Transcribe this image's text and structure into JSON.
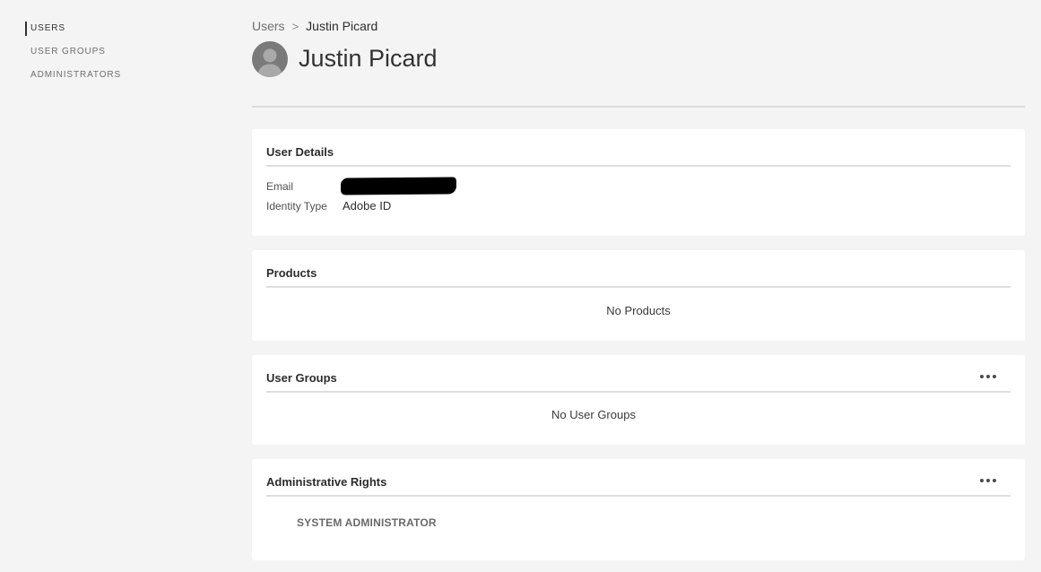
{
  "sidebar": {
    "items": [
      {
        "label": "USERS",
        "active": true
      },
      {
        "label": "USER GROUPS",
        "active": false
      },
      {
        "label": "ADMINISTRATORS",
        "active": false
      }
    ]
  },
  "breadcrumb": {
    "parent": "Users",
    "separator": ">",
    "current": "Justin Picard"
  },
  "user": {
    "name": "Justin Picard",
    "avatar_icon": "user-avatar-icon"
  },
  "user_details": {
    "title": "User Details",
    "email_label": "Email",
    "email_value": "[redacted]",
    "identity_label": "Identity Type",
    "identity_value": "Adobe ID"
  },
  "products": {
    "title": "Products",
    "empty_text": "No Products"
  },
  "user_groups": {
    "title": "User Groups",
    "empty_text": "No User Groups",
    "more_icon": "more-options-icon"
  },
  "admin_rights": {
    "title": "Administrative Rights",
    "role": "SYSTEM ADMINISTRATOR",
    "more_icon": "more-options-icon"
  },
  "colors": {
    "background": "#f4f4f4",
    "card": "#ffffff",
    "text": "#2c2c2c",
    "muted": "#6e6e6e",
    "avatar": "#7a7a7a"
  }
}
